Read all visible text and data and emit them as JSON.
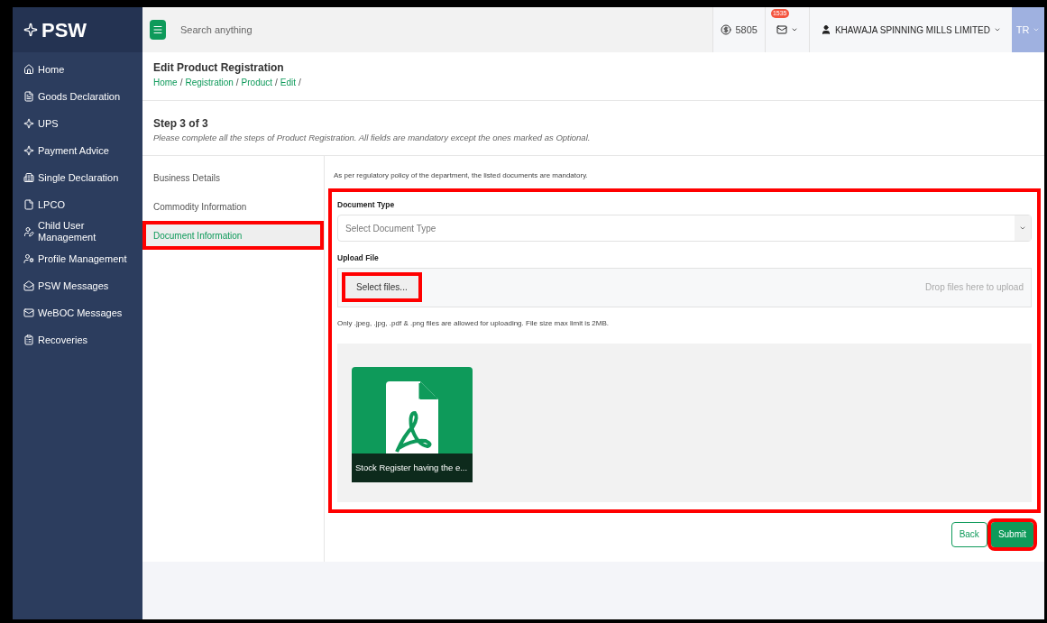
{
  "sidebar": {
    "logo": "PSW",
    "items": [
      {
        "label": "Home"
      },
      {
        "label": "Goods Declaration"
      },
      {
        "label": "UPS"
      },
      {
        "label": "Payment Advice"
      },
      {
        "label": "Single Declaration"
      },
      {
        "label": "LPCO"
      },
      {
        "label": "Child User Management"
      },
      {
        "label": "Profile Management"
      },
      {
        "label": "PSW Messages"
      },
      {
        "label": "WeBOC Messages"
      },
      {
        "label": "Recoveries"
      }
    ]
  },
  "topbar": {
    "search": {
      "placeholder": "Search anything"
    },
    "balance": "5805",
    "mail_badge": "1535",
    "company": "KHAWAJA SPINNING MILLS LIMITED",
    "user_initials": "TR"
  },
  "header": {
    "title": "Edit Product Registration",
    "breadcrumb": [
      {
        "kind": "link",
        "text": "Home"
      },
      {
        "kind": "separator",
        "text": "/"
      },
      {
        "kind": "link",
        "text": "Registration"
      },
      {
        "kind": "separator",
        "text": "/"
      },
      {
        "kind": "link",
        "text": "Product"
      },
      {
        "kind": "separator",
        "text": "/"
      },
      {
        "kind": "link",
        "text": "Edit"
      },
      {
        "kind": "separator",
        "text": "/"
      }
    ]
  },
  "step": {
    "title": "Step 3 of 3",
    "note": "Please complete all the steps of Product Registration. All fields are mandatory except the ones marked as Optional."
  },
  "steps": [
    {
      "label": "Business Details",
      "selected": false,
      "highlighted": false
    },
    {
      "label": "Commodity Information",
      "selected": false,
      "highlighted": false
    },
    {
      "label": "Document Information",
      "selected": true,
      "highlighted": true
    }
  ],
  "form": {
    "policy_note": "As per regulatory policy of the department, the listed documents are mandatory.",
    "highlighted": true,
    "document_type": {
      "label": "Document Type",
      "placeholder": "Select Document Type"
    },
    "upload": {
      "label": "Upload File",
      "button": "Select files...",
      "button_highlighted": true,
      "drop_hint": "Drop files here to upload",
      "rule": "Only .jpeg, .jpg, .pdf & .png files are allowed for uploading. File size max limit is 2MB."
    },
    "files": [
      {
        "name": "Stock Register having the e..."
      }
    ]
  },
  "actions": [
    {
      "label": "Back",
      "kind": "secondary",
      "highlighted": false
    },
    {
      "label": "Submit",
      "kind": "primary",
      "highlighted": true
    }
  ]
}
